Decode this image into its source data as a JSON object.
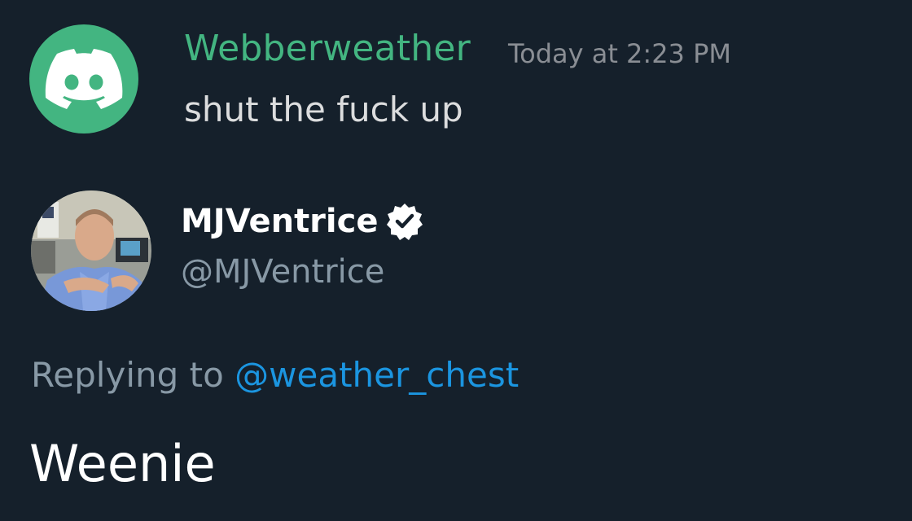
{
  "discord": {
    "username": "Webberweather",
    "timestamp": "Today at 2:23 PM",
    "message": "shut the fuck up",
    "avatar_icon": "discord-logo-icon",
    "colors": {
      "username": "#43b581",
      "avatar_bg": "#43b581"
    }
  },
  "tweet": {
    "display_name": "MJVentrice",
    "handle": "@MJVentrice",
    "verified_icon": "verified-badge-icon",
    "replying_prefix": "Replying to",
    "replying_handle": "@weather_chest",
    "body": "Weenie",
    "colors": {
      "background": "#15202b",
      "mention": "#1b95e0",
      "muted": "#8899a6"
    }
  }
}
